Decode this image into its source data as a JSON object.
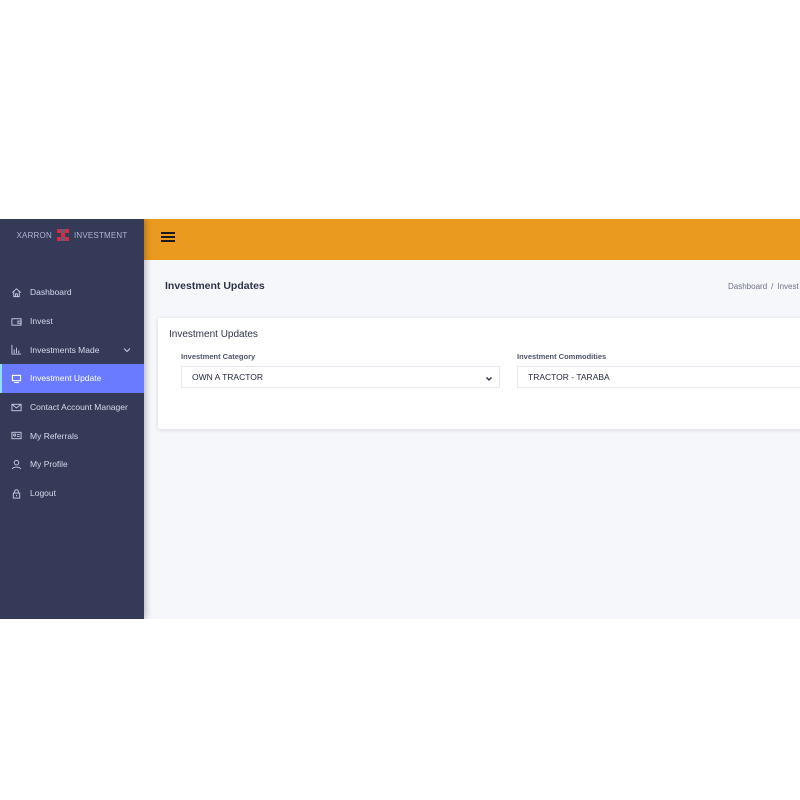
{
  "brand": {
    "left": "XARRON",
    "right": "INVESTMENT"
  },
  "sidebar": {
    "items": [
      {
        "label": "Dashboard",
        "icon": "home-icon"
      },
      {
        "label": "Invest",
        "icon": "wallet-icon"
      },
      {
        "label": "Investments Made",
        "icon": "bar-chart-icon",
        "has_submenu": true
      },
      {
        "label": "Investment Update",
        "icon": "monitor-icon",
        "active": true
      },
      {
        "label": "Contact Account Manager",
        "icon": "envelope-icon"
      },
      {
        "label": "My Referrals",
        "icon": "id-card-icon"
      },
      {
        "label": "My Profile",
        "icon": "user-icon"
      },
      {
        "label": "Logout",
        "icon": "lock-icon"
      }
    ]
  },
  "header": {
    "menu_icon": "hamburger-icon"
  },
  "page": {
    "title": "Investment Updates",
    "breadcrumb": {
      "home": "Dashboard",
      "separator": "/",
      "current": "Invest"
    }
  },
  "card": {
    "title": "Investment Updates",
    "category": {
      "label": "Investment Category",
      "value": "OWN A TRACTOR"
    },
    "commodities": {
      "label": "Investment Commodities",
      "value": "TRACTOR - TARABA"
    }
  },
  "colors": {
    "sidebar_bg": "#363a59",
    "active_item": "#6a7bff",
    "topbar": "#e99a1f",
    "content_bg": "#f6f7fb",
    "logo_red": "#d92b3a"
  }
}
